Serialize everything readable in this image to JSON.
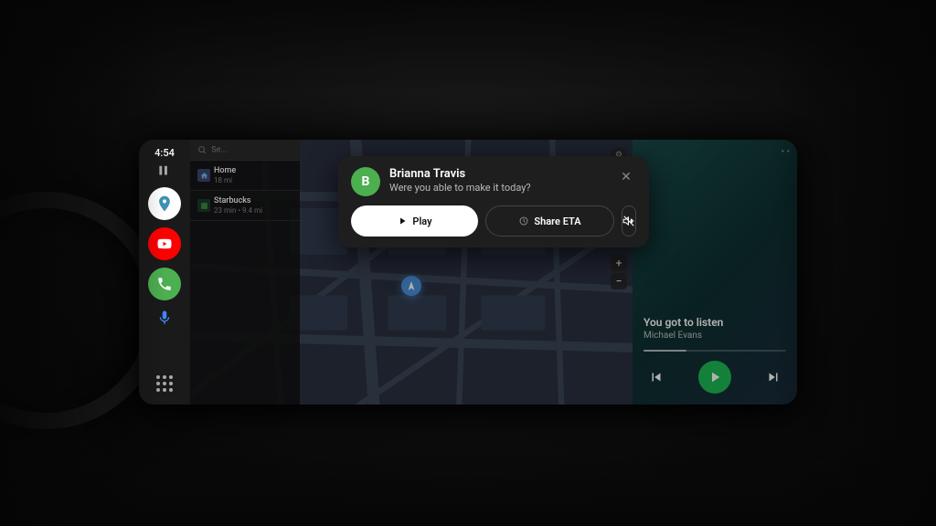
{
  "ui": {
    "background": "#0a0a0a"
  },
  "sidebar": {
    "time": "4:54",
    "signal": "▌▌",
    "apps": [
      {
        "name": "maps",
        "label": "Maps",
        "icon": "◎"
      },
      {
        "name": "youtube",
        "label": "YouTube",
        "icon": "▶"
      },
      {
        "name": "phone",
        "label": "Phone",
        "icon": "✆"
      }
    ],
    "grid_icon": "⋮⋮⋮"
  },
  "navigation": {
    "search_placeholder": "Se...",
    "items": [
      {
        "title": "Home",
        "subtitle": "18 mi",
        "icon": "⌂"
      },
      {
        "title": "Starbucks",
        "subtitle": "23 min • 9.4 mi",
        "icon": "☕"
      }
    ]
  },
  "music": {
    "title": "You got to listen",
    "artist": "Michael Evans",
    "progress": 30
  },
  "notification": {
    "sender": "Brianna Travis",
    "message": "Were you able to make it today?",
    "avatar_letter": "B",
    "avatar_color": "#4caf50",
    "actions": {
      "play": "Play",
      "share_eta": "Share ETA",
      "mute": "🔔"
    }
  }
}
